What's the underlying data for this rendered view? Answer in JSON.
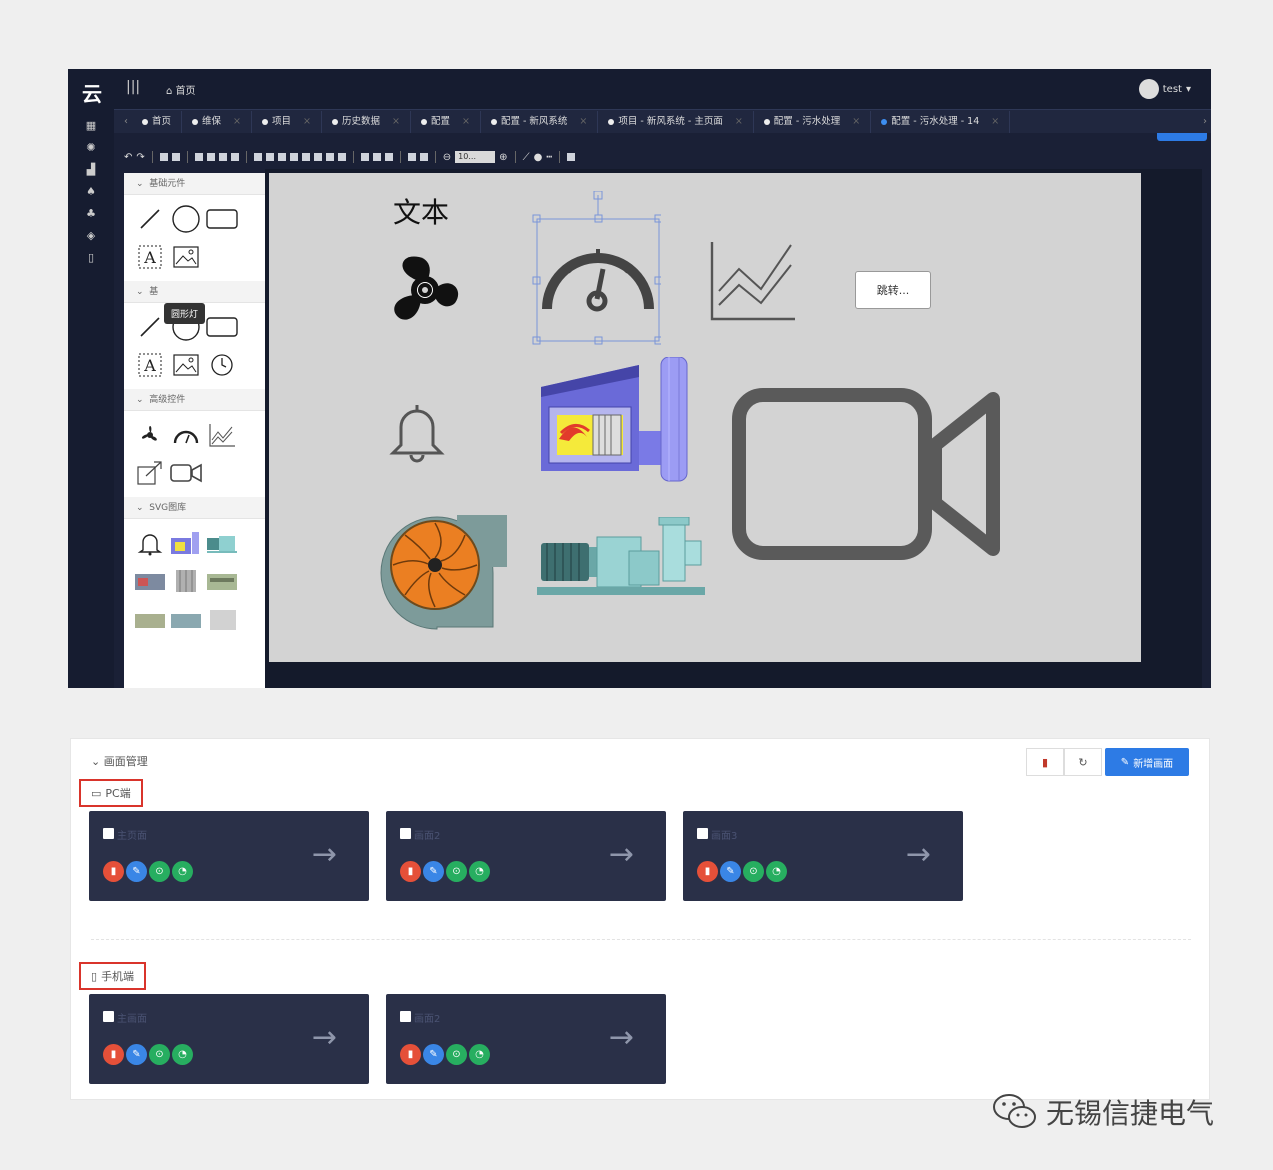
{
  "app": {
    "logo": "云",
    "menu_toggle": "|||",
    "home_crumb": "首页",
    "user": "test"
  },
  "tabs": [
    {
      "label": "首页"
    },
    {
      "label": "维保"
    },
    {
      "label": "项目"
    },
    {
      "label": "历史数据"
    },
    {
      "label": "配置"
    },
    {
      "label": "配置 - 新风系统"
    },
    {
      "label": "项目 - 新风系统 - 主页面"
    },
    {
      "label": "配置 - 污水处理"
    },
    {
      "label": "配置 - 污水处理 - 14",
      "active": true
    }
  ],
  "toolbar": {
    "zoom": "10..."
  },
  "palette": {
    "sections": [
      {
        "label": "基础元件"
      },
      {
        "label": "基"
      },
      {
        "label": "高级控件"
      },
      {
        "label": "SVG图库"
      }
    ],
    "tooltip": "圆形灯"
  },
  "canvas": {
    "text_element": "文本",
    "jump_button": "跳转..."
  },
  "management": {
    "title": "画面管理",
    "add_button": "新增画面",
    "pc_section": "PC端",
    "mobile_section": "手机端",
    "pc_cards": [
      {
        "name": "主页面"
      },
      {
        "name": "画面2"
      },
      {
        "name": "画面3"
      }
    ],
    "mobile_cards": [
      {
        "name": "主画面"
      },
      {
        "name": "画面2"
      }
    ]
  },
  "watermark": "无锡信捷电气",
  "colors": {
    "dark_bg": "#1a2036",
    "accent": "#2d7be5",
    "card_bg": "#2a3048",
    "highlight_border": "#d9342b"
  }
}
